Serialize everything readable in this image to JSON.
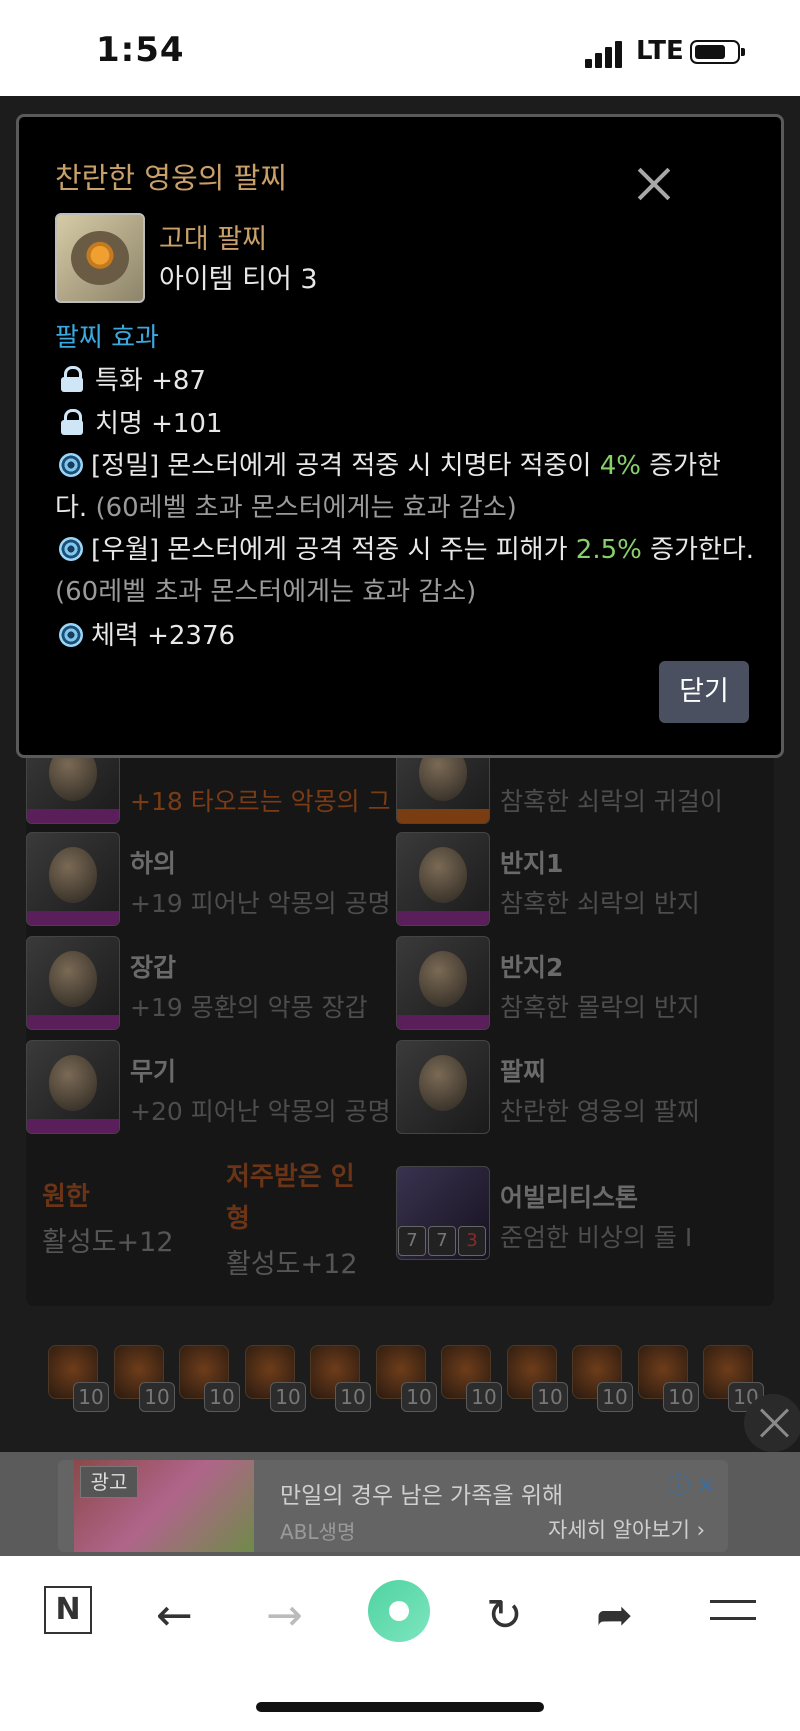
{
  "status_bar": {
    "time": "1:54",
    "carrier": "LTE"
  },
  "equipment": {
    "items": [
      {
        "slot": "",
        "name": "+18 타오르는 악몽의 그"
      },
      {
        "slot": "",
        "name": "참혹한 쇠락의 귀걸이"
      },
      {
        "slot": "하의",
        "name": "+19 피어난 악몽의 공명"
      },
      {
        "slot": "반지1",
        "name": "참혹한 쇠락의 반지"
      },
      {
        "slot": "장갑",
        "name": "+19 몽환의 악몽 장갑"
      },
      {
        "slot": "반지2",
        "name": "참혹한 몰락의 반지"
      },
      {
        "slot": "무기",
        "name": "+20 피어난 악몽의 공명"
      },
      {
        "slot": "팔찌",
        "name": "찬란한 영웅의 팔찌"
      },
      {
        "slot": "어빌리티스톤",
        "name": "준엄한 비상의 돌 I"
      }
    ],
    "stone_levels": [
      "7",
      "7",
      "3"
    ],
    "sub1_label": "원한",
    "sub1_value": "활성도+12",
    "sub2_label_line1": "저주받은 인",
    "sub2_label_line2": "형",
    "sub2_value": "활성도+12",
    "gem_levels": [
      "10",
      "10",
      "10",
      "10",
      "10",
      "10",
      "10",
      "10",
      "10",
      "10",
      "10"
    ]
  },
  "ad": {
    "tag": "광고",
    "title": "만일의 경우 남은 가족을 위해",
    "sponsor": "ABL생명",
    "more": "자세히 알아보기",
    "info_symbol": "ⓘ ✕"
  },
  "modal": {
    "title": "찬란한 영웅의 팔찌",
    "item_type": "고대 팔찌",
    "item_tier": "아이템 티어 3",
    "section": "팔찌 효과",
    "stat1": "특화 +87",
    "stat2": "치명 +101",
    "effect1_pre": "[정밀] 몬스터에게 공격 적중 시 치명타 적중이 ",
    "effect1_value": "4%",
    "effect1_post": " 증가한",
    "effect1_line2_pre": "다. ",
    "effect1_note": "(60레벨 초과 몬스터에게는 효과 감소)",
    "effect2_pre": "[우월] 몬스터에게 공격 적중 시 주는 피해가 ",
    "effect2_value": "2.5%",
    "effect2_post": " 증가한다.",
    "effect2_note": "(60레벨 초과 몬스터에게는 효과 감소)",
    "stat3": "체력 +2376",
    "close_label": "닫기",
    "colors": {
      "title": "#c9a06a",
      "section": "#3ca8e0",
      "value": "#86d16b"
    }
  }
}
